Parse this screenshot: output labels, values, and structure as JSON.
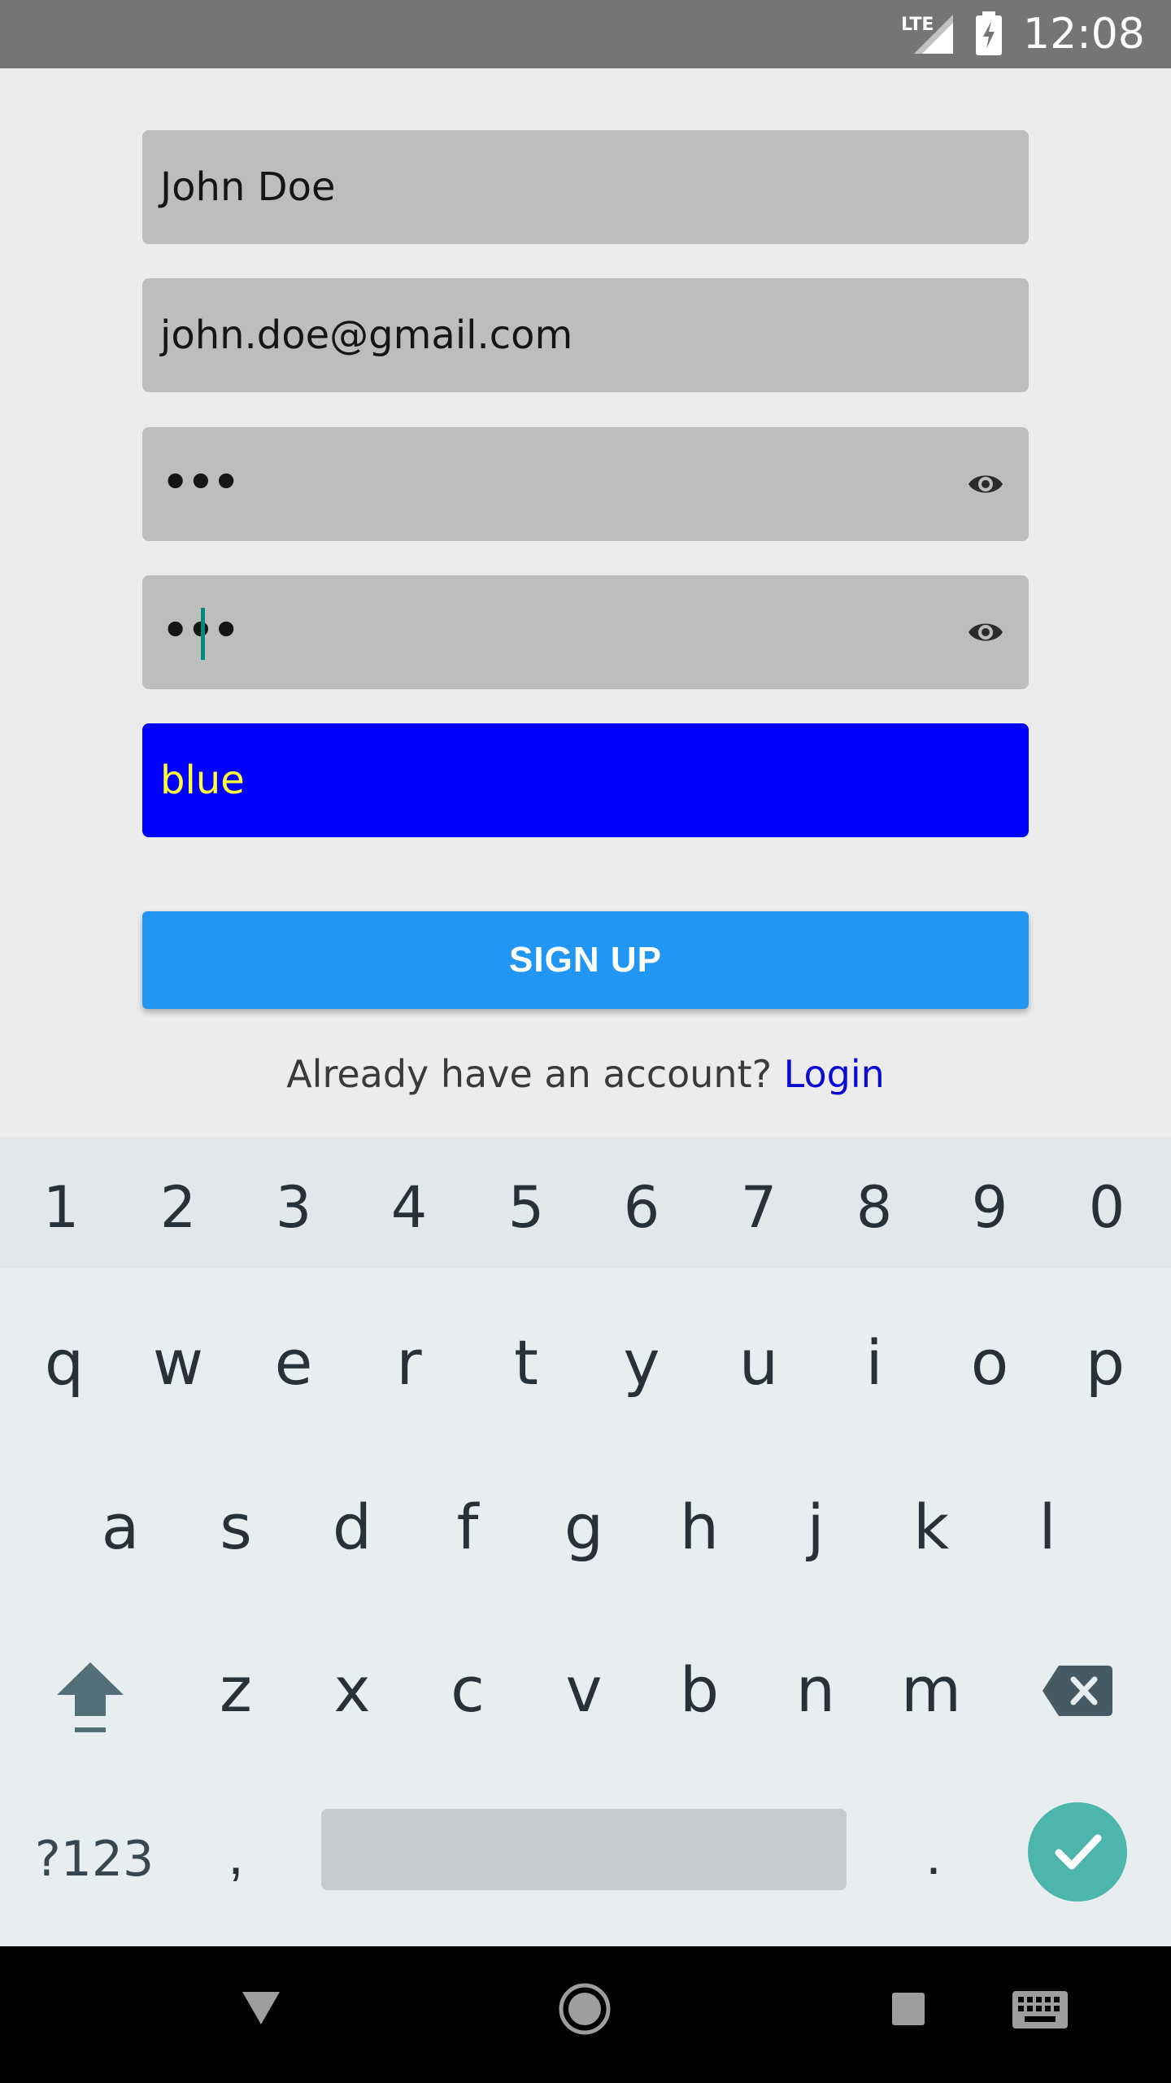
{
  "status_bar": {
    "network_label": "LTE",
    "time": "12:08"
  },
  "form": {
    "name_value": "John Doe",
    "email_value": "john.doe@gmail.com",
    "password_value": "•••",
    "confirm_password_value": "•••",
    "color_value": "blue",
    "color_field_background": "#0000ff",
    "color_field_text_color": "#ffff33",
    "signup_label": "SIGN UP",
    "signup_color": "#2196f3",
    "login_prompt": "Already have an account?",
    "login_link": "Login"
  },
  "keyboard": {
    "number_row": [
      "1",
      "2",
      "3",
      "4",
      "5",
      "6",
      "7",
      "8",
      "9",
      "0"
    ],
    "row1": [
      "q",
      "w",
      "e",
      "r",
      "t",
      "y",
      "u",
      "i",
      "o",
      "p"
    ],
    "row2": [
      "a",
      "s",
      "d",
      "f",
      "g",
      "h",
      "j",
      "k",
      "l"
    ],
    "row3": [
      "z",
      "x",
      "c",
      "v",
      "b",
      "n",
      "m"
    ],
    "symbols_label": "?123",
    "comma": ",",
    "period": ".",
    "shift_icon": "shift-icon",
    "delete_icon": "backspace-icon",
    "enter_icon": "checkmark-icon"
  },
  "nav_bar": {
    "icons": [
      "back-icon",
      "home-icon",
      "recents-icon",
      "keyboard-icon"
    ]
  }
}
